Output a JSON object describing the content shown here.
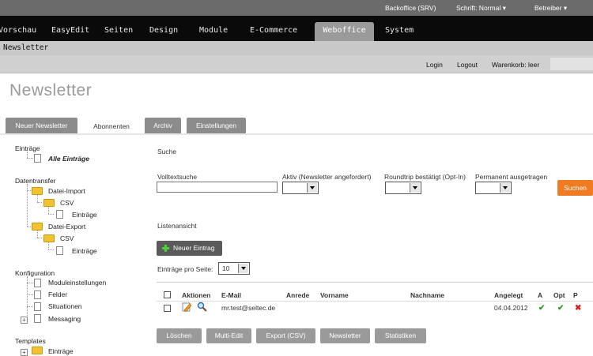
{
  "topbar": {
    "backoffice": "Backoffice (SRV)",
    "schrift": "Schrift: Normal ▾",
    "betreiber": "Betreiber ▾"
  },
  "mainmenu": {
    "items": [
      "Vorschau",
      "EasyEdit",
      "Seiten",
      "Design",
      "Module",
      "E-Commerce",
      "Weboffice",
      "System"
    ],
    "active": "Weboffice"
  },
  "breadcrumb": "Newsletter",
  "shopbar": {
    "login": "Login",
    "logout": "Logout",
    "cart": "Warenkorb: leer"
  },
  "page_title": "Newsletter",
  "tabs": [
    "Neuer Newsletter",
    "Abonnenten",
    "Archiv",
    "Einstellungen"
  ],
  "active_tab": "Abonnenten",
  "sidebar": {
    "eintraege_head": "Einträge",
    "alle_eintraege": "Alle Einträge",
    "datentransfer_head": "Datentransfer",
    "datei_import": "Datei-Import",
    "csv1": "CSV",
    "eintraege1": "Einträge",
    "datei_export": "Datei-Export",
    "csv2": "CSV",
    "eintraege2": "Einträge",
    "konfiguration_head": "Konfiguration",
    "moduleinstellungen": "Moduleinstellungen",
    "felder": "Felder",
    "situationen": "Situationen",
    "messaging": "Messaging",
    "templates_head": "Templates",
    "templates_eintraege": "Einträge"
  },
  "search": {
    "heading": "Suche",
    "volltext_label": "Volltextsuche",
    "volltext_value": "",
    "aktiv_label": "Aktiv (Newsletter angefordert)",
    "roundtrip_label": "Roundtrip bestätigt (Opt-In)",
    "permanent_label": "Permanent ausgetragen",
    "suchen_label": "Suchen"
  },
  "list": {
    "heading": "Listenansicht",
    "neuer_eintrag_label": "Neuer Eintrag",
    "per_page_label": "Einträge pro Seite:",
    "per_page_value": "10",
    "columns": [
      "Aktionen",
      "E-Mail",
      "Anrede",
      "Vorname",
      "Nachname",
      "Angelegt",
      "A",
      "Opt",
      "P"
    ],
    "rows": [
      {
        "email": "mr.test@seltec.de",
        "anrede": "",
        "vorname": "",
        "nachname": "",
        "angelegt": "04.04.2012",
        "a": "✔",
        "opt": "✔",
        "p": "✖"
      }
    ]
  },
  "bottom_buttons": [
    "Löschen",
    "Multi-Edit",
    "Export (CSV)",
    "Newsletter",
    "Statistiken"
  ],
  "colors": {
    "accent": "#f07b23",
    "menu_bg": "#0a0a0a",
    "active_tab": "#9a9a9a",
    "check": "#2e9c1e",
    "cross": "#d02020"
  },
  "icons": {
    "edit": "pencil-icon",
    "view": "magnifier-icon",
    "add": "plus-icon",
    "folder": "folder-icon",
    "document": "document-icon"
  }
}
